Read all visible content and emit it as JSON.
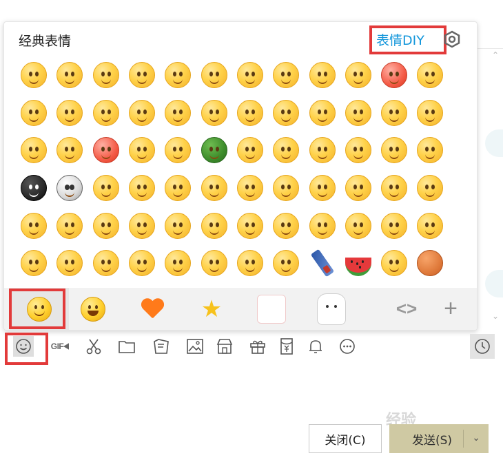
{
  "panel": {
    "title": "经典表情",
    "diy_label": "表情DIY",
    "rows": [
      [
        "smile",
        "shy",
        "heart-eyes",
        "angry-sweat",
        "sunglasses",
        "crying",
        "blush",
        "pitiful",
        "sleepy",
        "doze",
        "red-angry",
        "fire"
      ],
      [
        "tongue",
        "grin",
        "surprised",
        "sad",
        "cool",
        "sweat",
        "scold",
        "puke",
        "giggle",
        "smile-soft",
        "shock",
        "confused"
      ],
      [
        "drool",
        "smirk",
        "red-mad",
        "wipe-sweat",
        "laugh",
        "turtle",
        "bandana",
        "yell",
        "question",
        "think",
        "dizzy",
        "frown"
      ],
      [
        "bomb",
        "skull",
        "hammer",
        "tease",
        "wipe-sweat-2",
        "shush",
        "salute",
        "blush-lean",
        "grin-wide",
        "shy-blush",
        "shy-2",
        "yawn"
      ],
      [
        "fist",
        "sob",
        "faint",
        "smirk-2",
        "wink",
        "fury",
        "teary",
        "blah",
        "joy",
        "scheme",
        "tears-fly",
        "pout"
      ],
      [
        "hand-cover",
        "fist-2",
        "smug",
        "bleed",
        "shout",
        "bye",
        "sweet",
        "blush-hands",
        "knife",
        "watermelon",
        "beer",
        "basketball"
      ]
    ],
    "tabs": [
      "classic-emoji",
      "yellow-face",
      "heart",
      "star",
      "sticker",
      "cat"
    ],
    "nav_label": "<>",
    "add_label": "+"
  },
  "toolbar": {
    "gif_label": "GIF",
    "items": [
      "emoji",
      "gif",
      "scissors",
      "folder",
      "screenshot",
      "image",
      "shop",
      "gift",
      "red-packet",
      "notification",
      "more"
    ],
    "history": "clock"
  },
  "buttons": {
    "close_label": "关闭(C)",
    "send_label": "发送(S)"
  },
  "watermark": "经验",
  "colors": {
    "highlight": "#e23a3a",
    "link": "#1296db",
    "send_bg": "#cfc9a3"
  }
}
